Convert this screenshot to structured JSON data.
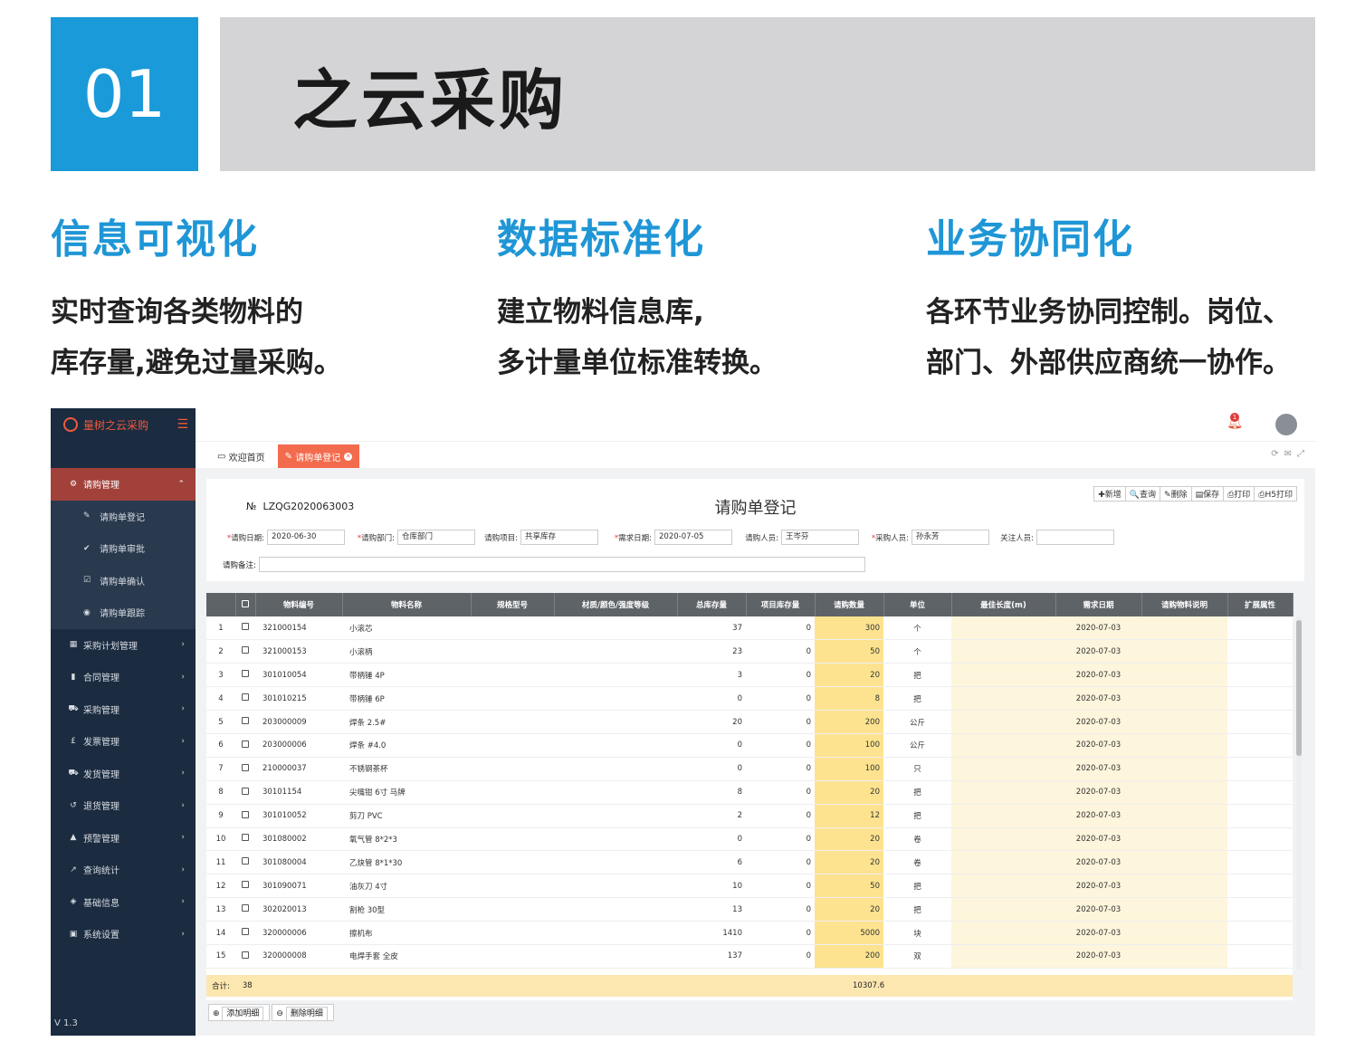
{
  "banner": {
    "number": "01",
    "title": "之云采购"
  },
  "features": [
    {
      "heading": "信息可视化",
      "line1": "实时查询各类物料的",
      "line2": "库存量,避免过量采购。"
    },
    {
      "heading": "数据标准化",
      "line1": "建立物料信息库,",
      "line2": "多计量单位标准转换。"
    },
    {
      "heading": "业务协同化",
      "line1": "各环节业务协同控制。岗位、",
      "line2": "部门、外部供应商统一协作。"
    }
  ],
  "app": {
    "logo_text": "量树之云采购",
    "version": "V 1.3",
    "notification_count": "1",
    "sidebar": [
      {
        "label": "请购管理",
        "icon": "⚙",
        "active": true,
        "children": [
          {
            "label": "请购单登记",
            "icon": "✎"
          },
          {
            "label": "请购单审批",
            "icon": "✔"
          },
          {
            "label": "请购单确认",
            "icon": "☑"
          },
          {
            "label": "请购单跟踪",
            "icon": "◉"
          }
        ]
      },
      {
        "label": "采购计划管理",
        "icon": "▦"
      },
      {
        "label": "合同管理",
        "icon": "▮"
      },
      {
        "label": "采购管理",
        "icon": "⛟"
      },
      {
        "label": "发票管理",
        "icon": "£"
      },
      {
        "label": "发货管理",
        "icon": "⛟"
      },
      {
        "label": "退货管理",
        "icon": "↺"
      },
      {
        "label": "预警管理",
        "icon": "▲"
      },
      {
        "label": "查询统计",
        "icon": "↗"
      },
      {
        "label": "基础信息",
        "icon": "◈"
      },
      {
        "label": "系统设置",
        "icon": "▣"
      }
    ],
    "tabs": [
      {
        "label": "欢迎首页",
        "icon": "▭"
      },
      {
        "label": "请购单登记",
        "icon": "✎"
      }
    ],
    "form": {
      "number_label": "№",
      "number": "LZQG2020063003",
      "title": "请购单登记",
      "actions": [
        "✚新增",
        "🔍查询",
        "✎删除",
        "▤保存",
        "⎙打印",
        "⎙H5打印"
      ],
      "fields": [
        {
          "label": "请购日期:",
          "value": "2020-06-30",
          "required": true
        },
        {
          "label": "请购部门:",
          "value": "仓库部门",
          "required": true
        },
        {
          "label": "请购项目:",
          "value": "共享库存",
          "required": false
        },
        {
          "label": "需求日期:",
          "value": "2020-07-05",
          "required": true
        },
        {
          "label": "请购人员:",
          "value": "王岑芬",
          "required": false
        },
        {
          "label": "采购人员:",
          "value": "孙永芳",
          "required": true
        },
        {
          "label": "关注人员:",
          "value": "",
          "required": false
        }
      ],
      "remark_label": "请购备注:"
    },
    "grid": {
      "headers": [
        "",
        "",
        "物料编号",
        "物料名称",
        "规格型号",
        "材质/颜色/强度等级",
        "总库存量",
        "项目库存量",
        "请购数量",
        "单位",
        "最佳长度(m)",
        "需求日期",
        "请购物料说明",
        "扩展属性"
      ],
      "rows": [
        [
          "1",
          "321000154",
          "小滚芯",
          "37",
          "0",
          "300",
          "个",
          "2020-07-03"
        ],
        [
          "2",
          "321000153",
          "小滚柄",
          "23",
          "0",
          "50",
          "个",
          "2020-07-03"
        ],
        [
          "3",
          "301010054",
          "带柄锤 4P",
          "3",
          "0",
          "20",
          "把",
          "2020-07-03"
        ],
        [
          "4",
          "301010215",
          "带柄锤 6P",
          "0",
          "0",
          "8",
          "把",
          "2020-07-03"
        ],
        [
          "5",
          "203000009",
          "焊条 2.5#",
          "20",
          "0",
          "200",
          "公斤",
          "2020-07-03"
        ],
        [
          "6",
          "203000006",
          "焊条 #4.0",
          "0",
          "0",
          "100",
          "公斤",
          "2020-07-03"
        ],
        [
          "7",
          "210000037",
          "不锈钢茶杯",
          "0",
          "0",
          "100",
          "只",
          "2020-07-03"
        ],
        [
          "8",
          "30101154",
          "尖嘴钳 6寸 马牌",
          "8",
          "0",
          "20",
          "把",
          "2020-07-03"
        ],
        [
          "9",
          "301010052",
          "剪刀 PVC",
          "2",
          "0",
          "12",
          "把",
          "2020-07-03"
        ],
        [
          "10",
          "301080002",
          "氧气管 8*2*3",
          "0",
          "0",
          "20",
          "卷",
          "2020-07-03"
        ],
        [
          "11",
          "301080004",
          "乙炔管 8*1*30",
          "6",
          "0",
          "20",
          "卷",
          "2020-07-03"
        ],
        [
          "12",
          "301090071",
          "油灰刀 4寸",
          "10",
          "0",
          "50",
          "把",
          "2020-07-03"
        ],
        [
          "13",
          "302020013",
          "割枪 30型",
          "13",
          "0",
          "20",
          "把",
          "2020-07-03"
        ],
        [
          "14",
          "320000006",
          "擦机布",
          "1410",
          "0",
          "5000",
          "块",
          "2020-07-03"
        ],
        [
          "15",
          "320000008",
          "电焊手套 全皮",
          "137",
          "0",
          "200",
          "双",
          "2020-07-03"
        ]
      ],
      "total_label": "合计:",
      "total_count": "38",
      "total_qty": "10307.6",
      "add_label": "添加明细",
      "delete_label": "删除明细"
    }
  }
}
